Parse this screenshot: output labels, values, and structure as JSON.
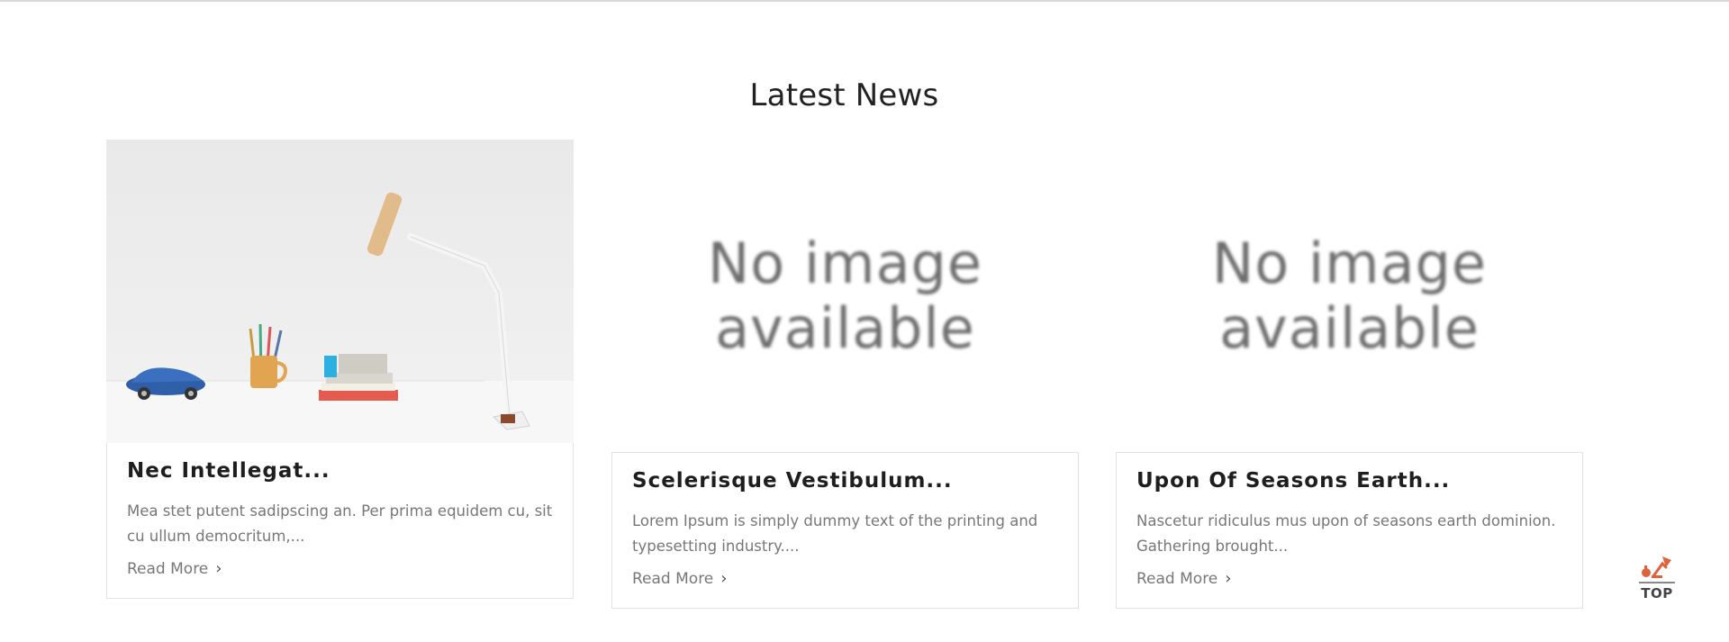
{
  "section": {
    "title": "Latest News"
  },
  "posts": [
    {
      "title": "Nec Intellegat...",
      "excerpt": "Mea stet putent sadipscing an. Per prima equidem cu, sit cu ullum democritum,...",
      "read_more": "Read More",
      "image": "desk-lamp-photo"
    },
    {
      "title": "Scelerisque Vestibulum...",
      "excerpt": "Lorem Ipsum is simply dummy text of the printing and typesetting industry....",
      "read_more": "Read More",
      "image_placeholder": [
        "No image",
        "available"
      ]
    },
    {
      "title": "Upon Of Seasons Earth...",
      "excerpt": "Nascetur ridiculus mus upon of seasons earth dominion. Gathering brought...",
      "read_more": "Read More",
      "image_placeholder": [
        "No image",
        "available"
      ]
    }
  ],
  "scroll_top": {
    "label": "TOP",
    "icon": "lamp-icon"
  },
  "colors": {
    "accent": "#e0623a",
    "muted_text": "#777777",
    "border": "#e3e3e3"
  }
}
